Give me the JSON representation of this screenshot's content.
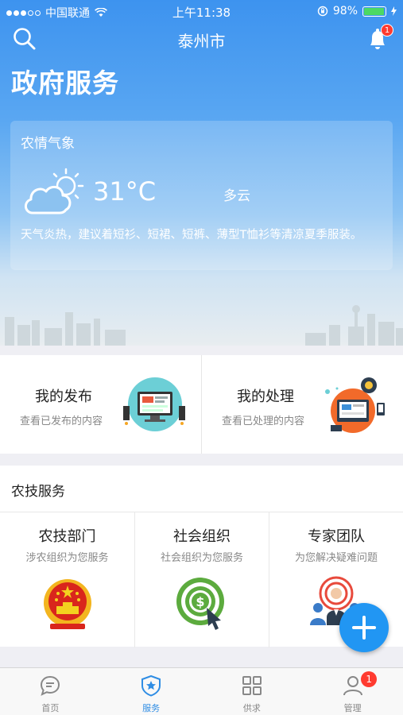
{
  "status_bar": {
    "carrier": "中国联通",
    "time": "上午11:38",
    "battery": "98%",
    "battery_level": 0.98
  },
  "nav": {
    "city": "泰州市",
    "notification_count": "1"
  },
  "page_title": "政府服务",
  "weather": {
    "section_title": "农情气象",
    "temperature": "31°C",
    "condition": "多云",
    "advice": "天气炎热，建议着短衫、短裙、短裤、薄型T恤衫等清凉夏季服装。"
  },
  "primary_cards": [
    {
      "title": "我的发布",
      "subtitle": "查看已发布的内容"
    },
    {
      "title": "我的处理",
      "subtitle": "查看已处理的内容"
    }
  ],
  "services": {
    "heading": "农技服务",
    "items": [
      {
        "title": "农技部门",
        "subtitle": "涉农组织为您服务"
      },
      {
        "title": "社会组织",
        "subtitle": "社会组织为您服务"
      },
      {
        "title": "专家团队",
        "subtitle": "为您解决疑难问题"
      }
    ]
  },
  "tabbar": {
    "tabs": [
      {
        "label": "首页"
      },
      {
        "label": "服务"
      },
      {
        "label": "供求"
      },
      {
        "label": "管理",
        "badge": "1"
      }
    ],
    "active_index": 1
  },
  "colors": {
    "primary": "#2f8de4",
    "fab": "#2196f3",
    "badge": "#ff3b30"
  }
}
